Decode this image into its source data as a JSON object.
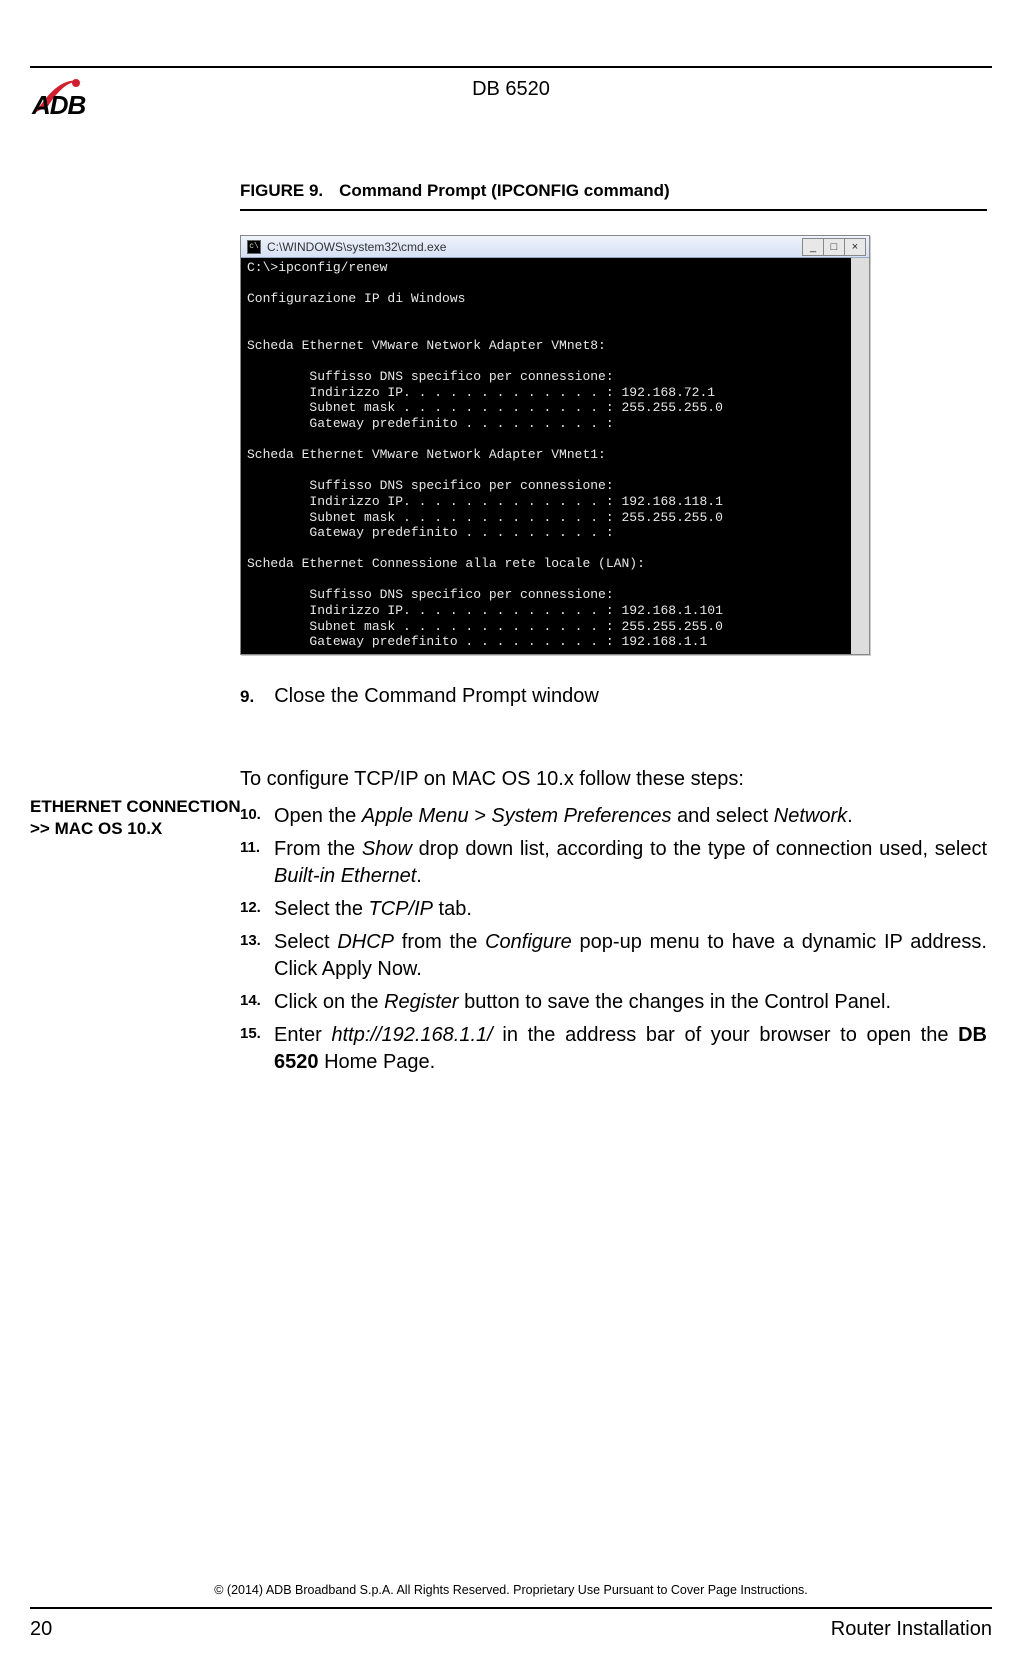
{
  "header": {
    "logo_text": "ADB",
    "doc_title": "DB 6520"
  },
  "figure": {
    "label": "FIGURE 9.",
    "title": "Command Prompt (IPCONFIG command)"
  },
  "terminal": {
    "title": "C:\\WINDOWS\\system32\\cmd.exe",
    "icon_glyph": "c\\",
    "min": "_",
    "max": "□",
    "close": "×",
    "body": "C:\\>ipconfig/renew\n\nConfigurazione IP di Windows\n\n\nScheda Ethernet VMware Network Adapter VMnet8:\n\n        Suffisso DNS specifico per connessione:\n        Indirizzo IP. . . . . . . . . . . . . : 192.168.72.1\n        Subnet mask . . . . . . . . . . . . . : 255.255.255.0\n        Gateway predefinito . . . . . . . . . :\n\nScheda Ethernet VMware Network Adapter VMnet1:\n\n        Suffisso DNS specifico per connessione:\n        Indirizzo IP. . . . . . . . . . . . . : 192.168.118.1\n        Subnet mask . . . . . . . . . . . . . : 255.255.255.0\n        Gateway predefinito . . . . . . . . . :\n\nScheda Ethernet Connessione alla rete locale (LAN):\n\n        Suffisso DNS specifico per connessione:\n        Indirizzo IP. . . . . . . . . . . . . : 192.168.1.101\n        Subnet mask . . . . . . . . . . . . . : 255.255.255.0\n        Gateway predefinito . . . . . . . . . : 192.168.1.1"
  },
  "step9": {
    "num": "9.",
    "text": "Close the Command Prompt window"
  },
  "sidebar": {
    "heading_l1": "ETHERNET CONNECTION",
    "heading_l2": ">> MAC OS 10.X"
  },
  "mac": {
    "intro": "To configure TCP/IP on MAC OS 10.x follow these steps:",
    "steps": [
      {
        "num": "10.",
        "parts": [
          {
            "t": "Open the "
          },
          {
            "t": "Apple Menu > System Preferences",
            "i": true
          },
          {
            "t": " and select "
          },
          {
            "t": "Network",
            "i": true
          },
          {
            "t": "."
          }
        ]
      },
      {
        "num": "11.",
        "parts": [
          {
            "t": "From the "
          },
          {
            "t": "Show",
            "i": true
          },
          {
            "t": " drop down list, according to the type of connection used, select "
          },
          {
            "t": "Built-in Ethernet",
            "i": true
          },
          {
            "t": "."
          }
        ]
      },
      {
        "num": "12.",
        "parts": [
          {
            "t": "Select the "
          },
          {
            "t": "TCP/IP",
            "i": true
          },
          {
            "t": " tab."
          }
        ]
      },
      {
        "num": "13.",
        "parts": [
          {
            "t": "Select "
          },
          {
            "t": "DHCP",
            "i": true
          },
          {
            "t": " from the "
          },
          {
            "t": "Configure",
            "i": true
          },
          {
            "t": " pop-up menu to have a dynamic IP address. Click Apply Now."
          }
        ]
      },
      {
        "num": "14.",
        "parts": [
          {
            "t": "Click on the "
          },
          {
            "t": "Register",
            "i": true
          },
          {
            "t": " button to save the changes in the Control Panel."
          }
        ]
      },
      {
        "num": "15.",
        "parts": [
          {
            "t": "Enter "
          },
          {
            "t": "http://192.168.1.1/",
            "i": true
          },
          {
            "t": " in the address bar of your browser to open the "
          },
          {
            "t": "DB 6520 ",
            "b": true
          },
          {
            "t": " Home Page."
          }
        ]
      }
    ]
  },
  "footer": {
    "copyright": "© (2014) ADB Broadband S.p.A. All Rights Reserved. Proprietary Use Pursuant to Cover Page Instructions.",
    "page": "20",
    "section": "Router Installation"
  }
}
